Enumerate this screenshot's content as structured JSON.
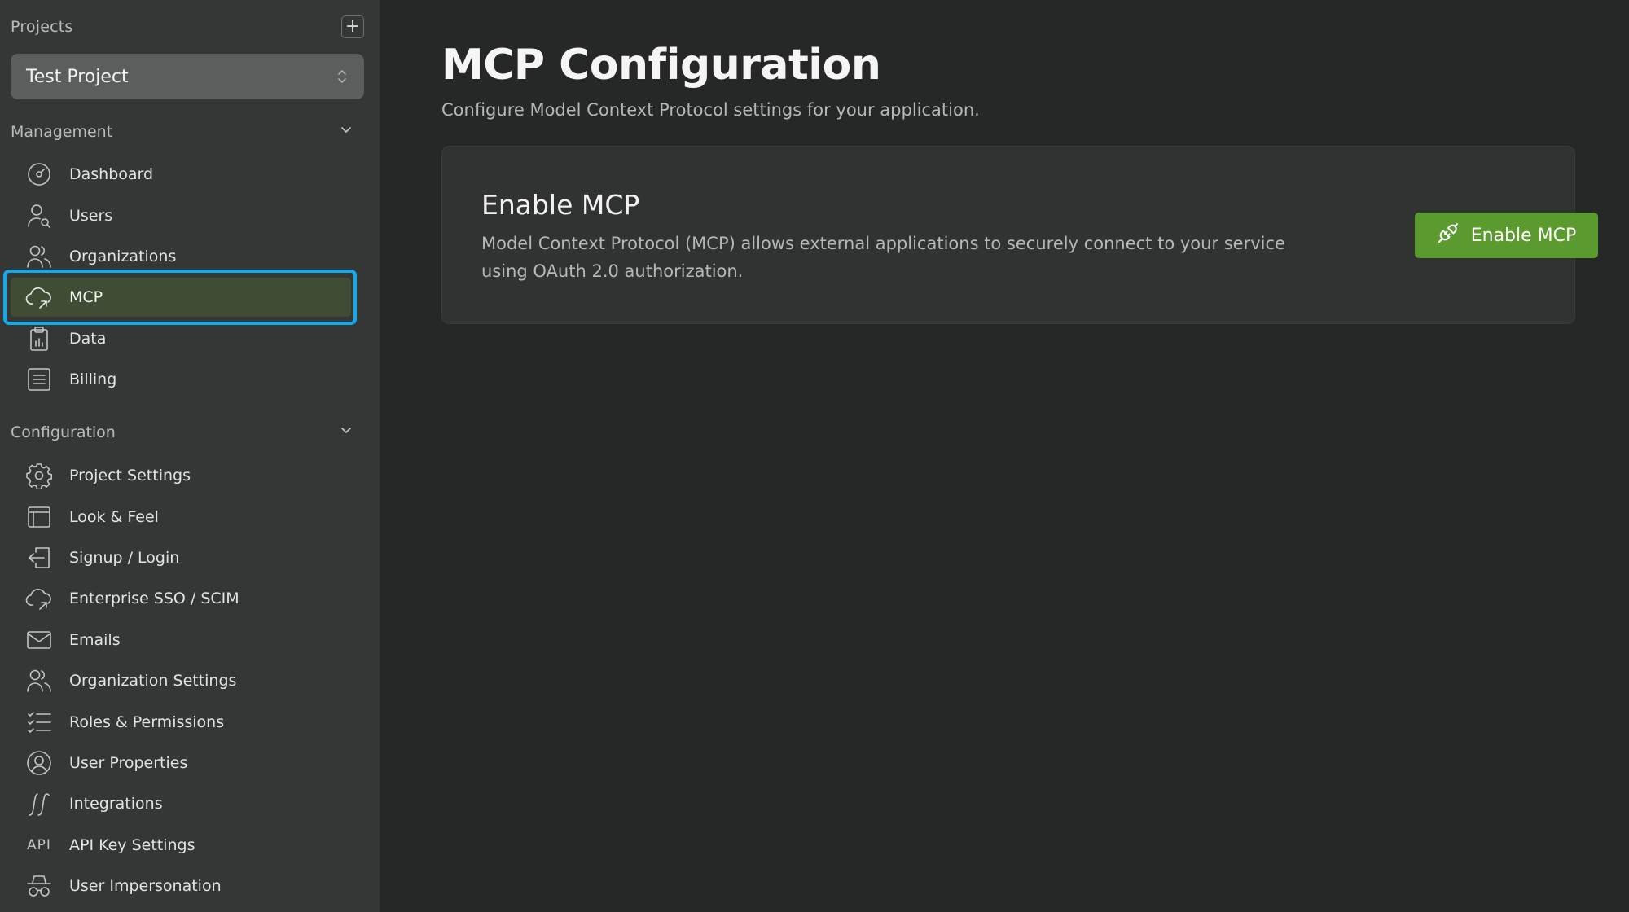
{
  "sidebar": {
    "projects_label": "Projects",
    "add_project_symbol": "+",
    "project_select": {
      "value": "Test Project"
    },
    "management": {
      "label": "Management",
      "items": [
        {
          "label": "Dashboard",
          "icon": "dashboard-gauge-icon"
        },
        {
          "label": "Users",
          "icon": "user-search-icon"
        },
        {
          "label": "Organizations",
          "icon": "people-icon"
        },
        {
          "label": "MCP",
          "icon": "cloud-arrow-icon",
          "active": true
        },
        {
          "label": "Data",
          "icon": "clipboard-chart-icon"
        },
        {
          "label": "Billing",
          "icon": "receipt-icon"
        }
      ]
    },
    "configuration": {
      "label": "Configuration",
      "items": [
        {
          "label": "Project Settings",
          "icon": "gear-icon"
        },
        {
          "label": "Look & Feel",
          "icon": "browser-window-icon"
        },
        {
          "label": "Signup / Login",
          "icon": "login-icon"
        },
        {
          "label": "Enterprise SSO / SCIM",
          "icon": "cloud-arrow-icon"
        },
        {
          "label": "Emails",
          "icon": "envelope-icon"
        },
        {
          "label": "Organization Settings",
          "icon": "people-icon"
        },
        {
          "label": "Roles & Permissions",
          "icon": "checklist-icon"
        },
        {
          "label": "User Properties",
          "icon": "user-circle-icon"
        },
        {
          "label": "Integrations",
          "icon": "integral-icon"
        },
        {
          "label": "API Key Settings",
          "icon": "api-text-icon",
          "icon_text": "API"
        },
        {
          "label": "User Impersonation",
          "icon": "spy-glasses-icon"
        }
      ]
    }
  },
  "main": {
    "title": "MCP Configuration",
    "subtitle": "Configure Model Context Protocol settings for your application.",
    "card": {
      "title": "Enable MCP",
      "description": "Model Context Protocol (MCP) allows external applications to securely connect to your service using OAuth 2.0 authorization.",
      "button_label": "Enable MCP",
      "button_icon": "plug-icon"
    }
  },
  "colors": {
    "sidebar_bg": "#353736",
    "main_bg": "#262827",
    "card_bg": "#313332",
    "active_item_bg": "#3e4d33",
    "highlight_border": "#16a9e8",
    "primary_button": "#5a9a2e"
  }
}
